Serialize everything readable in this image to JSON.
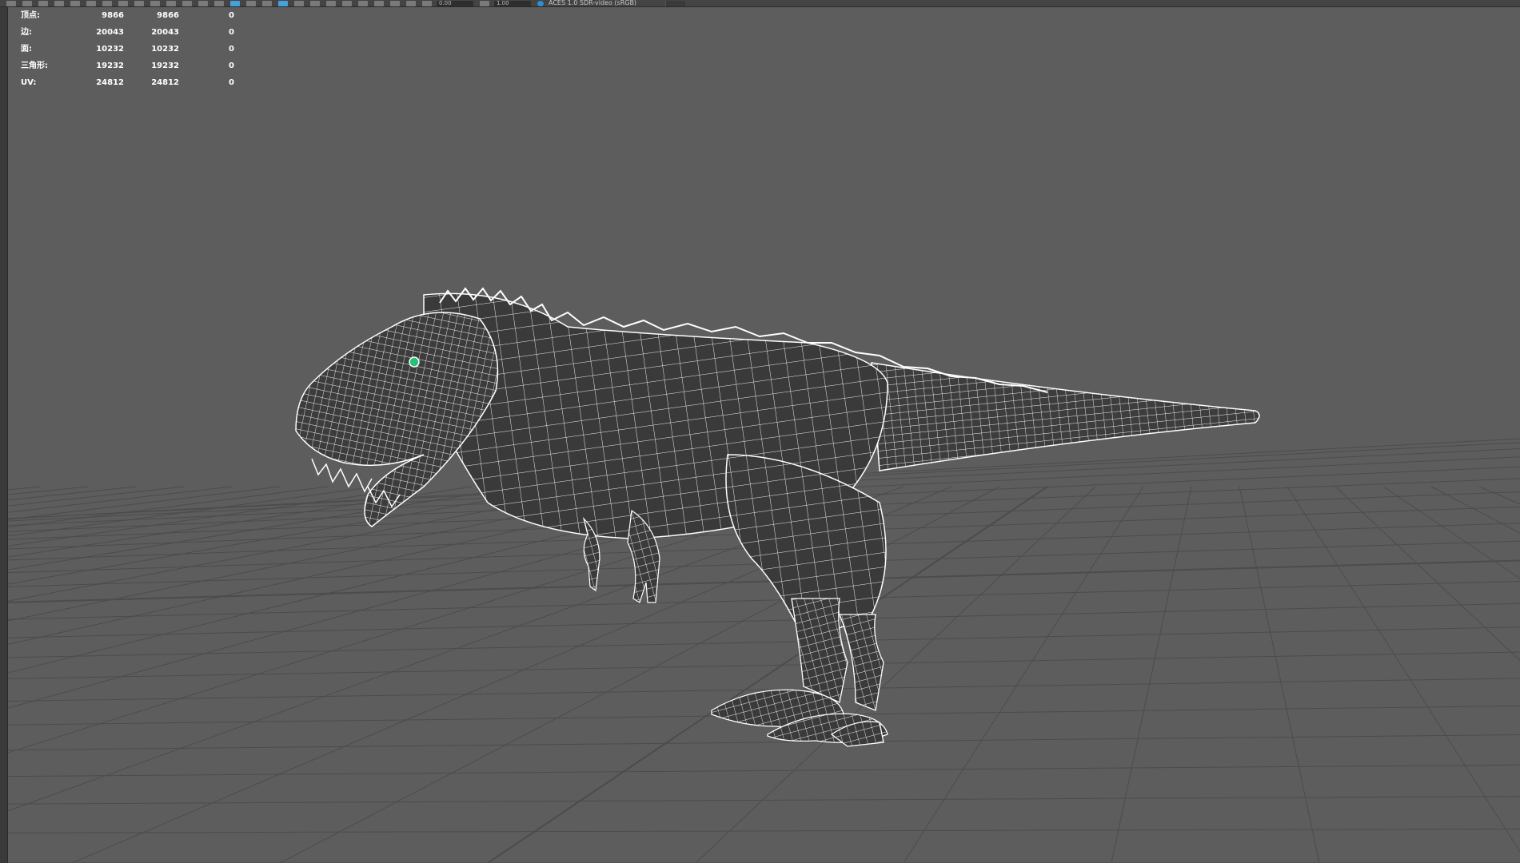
{
  "toolbar": {
    "field_1": "0.00",
    "field_2": "1.00",
    "colorspace_label": "ACES 1.0 SDR-video (sRGB)",
    "accent_color": "#2f8fd0"
  },
  "hud": {
    "rows": [
      {
        "label": "顶点:",
        "c1": "9866",
        "c2": "9866",
        "c3": "0"
      },
      {
        "label": "边:",
        "c1": "20043",
        "c2": "20043",
        "c3": "0"
      },
      {
        "label": "面:",
        "c1": "10232",
        "c2": "10232",
        "c3": "0"
      },
      {
        "label": "三角形:",
        "c1": "19232",
        "c2": "19232",
        "c3": "0"
      },
      {
        "label": "UV:",
        "c1": "24812",
        "c2": "24812",
        "c3": "0"
      }
    ]
  },
  "viewport": {
    "background": "#5d5d5d",
    "grid_color": "#4c4c4c",
    "wire_color": "#ffffff",
    "eye_color": "#29c07a"
  }
}
